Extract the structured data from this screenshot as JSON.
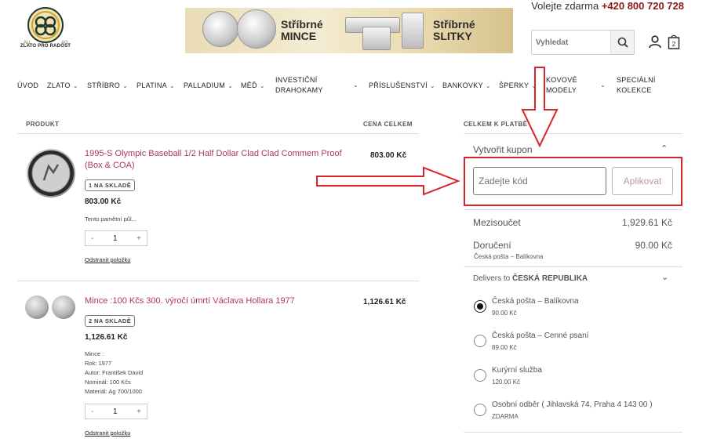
{
  "header": {
    "phone_prefix": "Volejte zdarma",
    "phone_number": "+420 800 720 728",
    "logo_text": "ZLATO PRO RADOST",
    "logo_small_left": "AU",
    "logo_small_right": "AG",
    "banner_coins_text": "Stříbrné MINCE",
    "banner_bars_text": "Stříbrné SLITKY",
    "search_placeholder": "Vyhledat"
  },
  "nav": [
    {
      "label": "ÚVOD",
      "chevron": false
    },
    {
      "label": "ZLATO",
      "chevron": true
    },
    {
      "label": "STŘÍBRO",
      "chevron": true
    },
    {
      "label": "PLATINA",
      "chevron": true
    },
    {
      "label": "PALLADIUM",
      "chevron": true
    },
    {
      "label": "MĚĎ",
      "chevron": true
    },
    {
      "label_line1": "INVESTIČNÍ",
      "label_line2": "DRAHOKAMY",
      "chevron": true
    },
    {
      "label": "PŘÍSLUŠENSTVÍ",
      "chevron": true
    },
    {
      "label": "BANKOVKY",
      "chevron": true
    },
    {
      "label": "ŠPERKY",
      "chevron": true
    },
    {
      "label_line1": "KOVOVÉ",
      "label_line2": "MODELY",
      "chevron": true
    },
    {
      "label_line1": "SPECIÁLNÍ",
      "label_line2": "KOLEKCE",
      "chevron": false
    }
  ],
  "cart": {
    "col_product": "PRODUKT",
    "col_total": "CENA CELKEM",
    "items": [
      {
        "title": "1995-S Olympic Baseball 1/2 Half Dollar Clad Clad Commem Proof (Box & COA)",
        "stock": "1 NA SKLADĚ",
        "unit_price": "803.00 Kč",
        "desc_lines": [
          "Tento pamětní půl..."
        ],
        "qty": "1",
        "minus": "-",
        "plus": "+",
        "remove": "Odstranit položku",
        "total": "803.00 Kč"
      },
      {
        "title": "Mince :100 Kčs 300. výročí úmrtí Václava Hollara 1977",
        "stock": "2 NA SKLADĚ",
        "unit_price": "1,126.61 Kč",
        "desc_lines": [
          "Mince :",
          "Rok: 1977",
          "Autor: František David",
          "Nominál: 100 Kčs",
          "Materiál: Ag 700/1000"
        ],
        "qty": "1",
        "minus": "-",
        "plus": "+",
        "remove": "Odstranit položku",
        "total": "1,126.61 Kč"
      }
    ]
  },
  "summary": {
    "heading": "CELKEM K PLATBĚ",
    "coupon_title": "Vytvořit kupon",
    "coupon_placeholder": "Zadejte kód",
    "coupon_button": "Aplikovat",
    "subtotal_label": "Mezisoučet",
    "subtotal_value": "1,929.61 Kč",
    "shipping_label": "Doručení",
    "shipping_method": "Česká pošta – Balíkovna",
    "shipping_value": "90.00 Kč",
    "delivers_to_prefix": "Delivers to",
    "delivers_to_country": "ČESKÁ REPUBLIKA",
    "shipping_options": [
      {
        "name": "Česká pošta – Balíkovna",
        "price": "90.00 Kč",
        "selected": true
      },
      {
        "name": "Česká pošta – Cenné psaní",
        "price": "89.00 Kč",
        "selected": false
      },
      {
        "name": "Kurýrní služba",
        "price": "120.00 Kč",
        "selected": false
      },
      {
        "name": "Osobní odběr ( Jihlavská 74, Praha 4 143 00 )",
        "price": "ZDARMA",
        "selected": false
      }
    ]
  },
  "colors": {
    "accent_red": "#d8232a",
    "product_title": "#b0365a",
    "phone_number": "#8a1a1a"
  }
}
